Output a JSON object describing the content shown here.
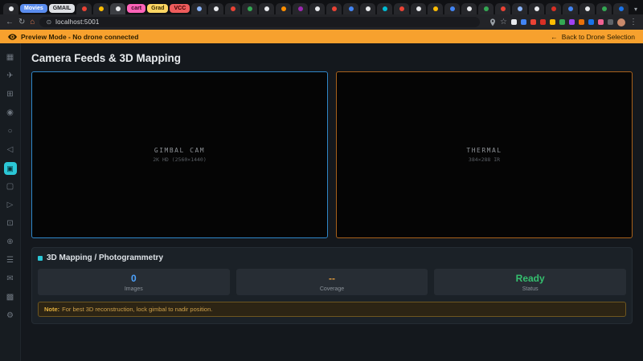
{
  "browser": {
    "url": "localhost:5001",
    "nav": {
      "back": "←",
      "reload": "↻",
      "home": "⌂"
    },
    "star": "☆",
    "menu": "⋮",
    "chevron": "▾",
    "avatar_color": "#c98a6b",
    "tabs": [
      {
        "color": "#e8eaed"
      },
      {
        "label": "Movies",
        "color": "#5b8def",
        "text": "#ffffff"
      },
      {
        "label": "GMAIL",
        "color": "#dfe1e5",
        "text": "#202124"
      },
      {
        "color": "#ea4335"
      },
      {
        "color": "#fbbc04"
      },
      {
        "color": "#e8eaed",
        "active": true
      },
      {
        "label": "cart",
        "color": "#ff63b8",
        "text": "#3c0d27"
      },
      {
        "label": "Grad",
        "color": "#fdd663",
        "text": "#3c2e00"
      },
      {
        "label": "VCC",
        "color": "#ee5c5c",
        "text": "#3c0000"
      },
      {
        "color": "#8ab4f8"
      },
      {
        "color": "#e8eaed"
      },
      {
        "color": "#ea4335"
      },
      {
        "color": "#34a853"
      },
      {
        "color": "#e8eaed"
      },
      {
        "color": "#ff8f00"
      },
      {
        "color": "#9c27b0"
      },
      {
        "color": "#e8eaed"
      },
      {
        "color": "#ea4335"
      },
      {
        "color": "#4285f4"
      },
      {
        "color": "#e8eaed"
      },
      {
        "color": "#00bcd4"
      },
      {
        "color": "#ea4335"
      },
      {
        "color": "#e8eaed"
      },
      {
        "color": "#fbbc04"
      },
      {
        "color": "#4285f4"
      },
      {
        "color": "#e8eaed"
      },
      {
        "color": "#34a853"
      },
      {
        "color": "#ea4335"
      },
      {
        "color": "#8ab4f8"
      },
      {
        "color": "#e8eaed"
      },
      {
        "color": "#d93025"
      },
      {
        "color": "#4285f4"
      },
      {
        "color": "#e8eaed"
      },
      {
        "color": "#34a853"
      },
      {
        "color": "#1a73e8"
      }
    ],
    "extensions": [
      "#e8eaed",
      "#4285f4",
      "#ea4335",
      "#d93025",
      "#fbbc04",
      "#34a853",
      "#a142f4",
      "#e8710a",
      "#1a73e8",
      "#f06292",
      "#5f6368"
    ]
  },
  "banner": {
    "background": "#f7a12e",
    "message": "Preview Mode - No drone connected",
    "back_arrow": "←",
    "back_link": "Back to Drone Selection"
  },
  "sidebar": {
    "active_index": 6,
    "active_color": "#2bc7d6",
    "icons": [
      {
        "name": "dashboard-icon",
        "glyph": "▦"
      },
      {
        "name": "missions-icon",
        "glyph": "✈"
      },
      {
        "name": "map-icon",
        "glyph": "⊞"
      },
      {
        "name": "target-icon",
        "glyph": "◉"
      },
      {
        "name": "geofence-icon",
        "glyph": "○"
      },
      {
        "name": "telemetry-icon",
        "glyph": "◁"
      },
      {
        "name": "camera-icon",
        "glyph": "▣"
      },
      {
        "name": "logs-icon",
        "glyph": "▢"
      },
      {
        "name": "video-icon",
        "glyph": "▷"
      },
      {
        "name": "layers-icon",
        "glyph": "⊡"
      },
      {
        "name": "plugins-icon",
        "glyph": "⊕"
      },
      {
        "name": "list-icon",
        "glyph": "☰"
      },
      {
        "name": "messages-icon",
        "glyph": "✉"
      },
      {
        "name": "grid-icon",
        "glyph": "▩"
      },
      {
        "name": "settings-icon",
        "glyph": "⚙"
      }
    ]
  },
  "page": {
    "title": "Camera Feeds & 3D Mapping",
    "feeds": [
      {
        "name": "GIMBAL CAM",
        "subtitle": "2K HD (2560×1440)",
        "accent": "#2f86c8"
      },
      {
        "name": "THERMAL",
        "subtitle": "384×288 IR",
        "accent": "#a8611b"
      }
    ],
    "mapping": {
      "title": "3D Mapping / Photogrammetry",
      "accent": "#2bc7d6",
      "stats": [
        {
          "value": "0",
          "label": "Images",
          "color": "#4da3ff"
        },
        {
          "value": "--",
          "label": "Coverage",
          "color": "#e09b3d"
        },
        {
          "value": "Ready",
          "label": "Status",
          "color": "#35c06f"
        }
      ],
      "note_label": "Note:",
      "note_text": "For best 3D reconstruction, lock gimbal to nadir position."
    }
  }
}
